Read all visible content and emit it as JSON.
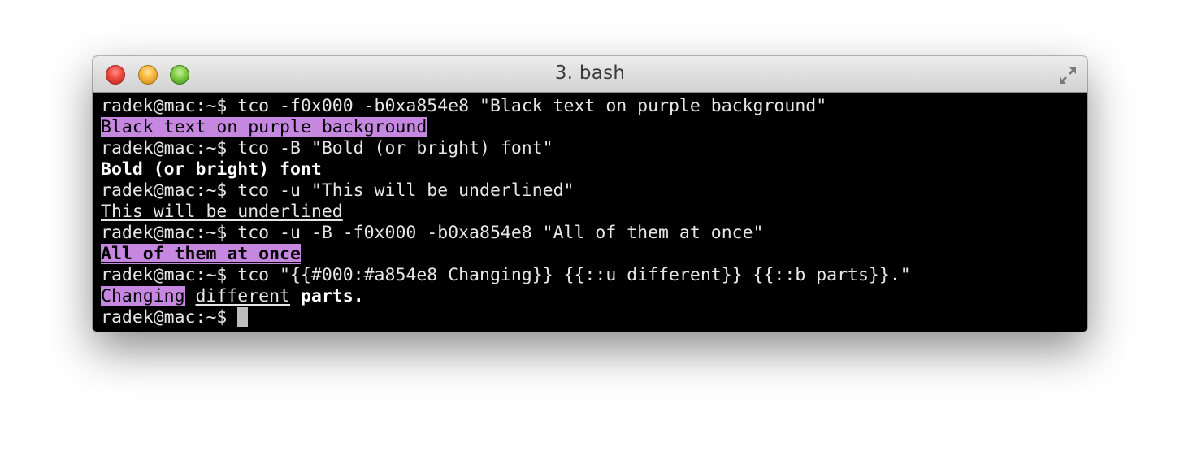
{
  "window": {
    "title": "3. bash"
  },
  "terminal": {
    "prompt": "radek@mac:~$ ",
    "commands": [
      "tco -f0x000 -b0xa854e8 \"Black text on purple background\"",
      "tco -B \"Bold (or bright) font\"",
      "tco -u \"This will be underlined\"",
      "tco -u -B -f0x000 -b0xa854e8 \"All of them at once\"",
      "tco \"{{#000:#a854e8 Changing}} {{::u different}} {{::b parts}}.\""
    ],
    "outputs": [
      "Black text on purple background",
      "Bold (or bright) font",
      "This will be underlined",
      "All of them at once"
    ],
    "parts": {
      "changing": "Changing",
      "space": " ",
      "different": "different",
      "parts": "parts",
      "period": "."
    }
  },
  "colors": {
    "highlight_bg": "#c587e0",
    "terminal_bg": "#000000",
    "text": "#e6e6e6"
  },
  "icons": {
    "close": "close-icon",
    "minimize": "minimize-icon",
    "zoom": "zoom-icon",
    "fullscreen": "fullscreen-arrows-icon"
  }
}
